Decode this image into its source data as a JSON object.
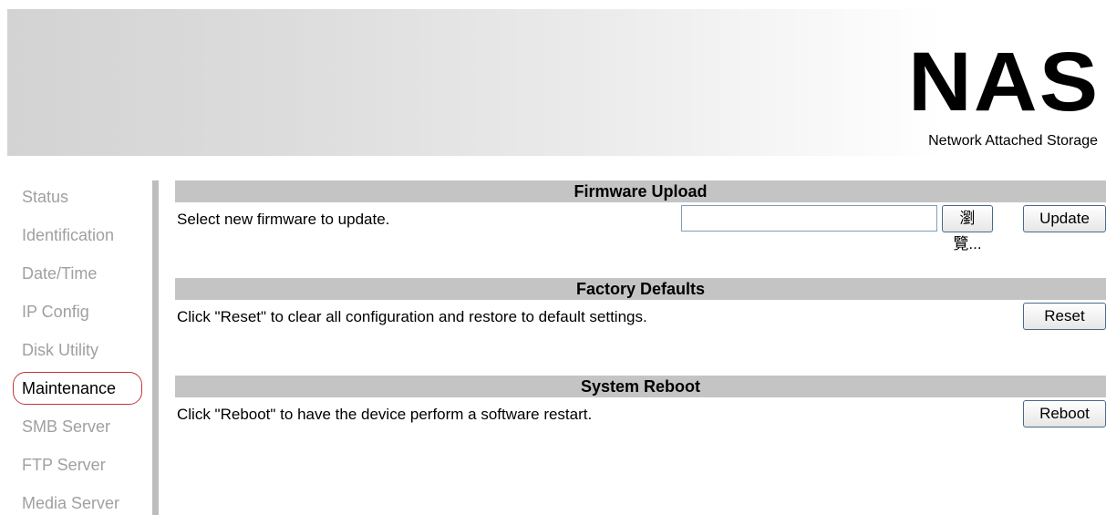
{
  "header": {
    "logo": "NAS",
    "subtitle": "Network Attached Storage"
  },
  "sidebar": {
    "items": [
      {
        "label": "Status",
        "active": false
      },
      {
        "label": "Identification",
        "active": false
      },
      {
        "label": "Date/Time",
        "active": false
      },
      {
        "label": "IP Config",
        "active": false
      },
      {
        "label": "Disk Utility",
        "active": false
      },
      {
        "label": "Maintenance",
        "active": true
      },
      {
        "label": "SMB Server",
        "active": false
      },
      {
        "label": "FTP Server",
        "active": false
      },
      {
        "label": "Media Server",
        "active": false
      }
    ]
  },
  "firmware": {
    "title": "Firmware Upload",
    "text": "Select new firmware to update.",
    "file_value": "",
    "browse_label": "瀏覽...",
    "update_label": "Update"
  },
  "factory": {
    "title": "Factory Defaults",
    "text": "Click \"Reset\" to clear all configuration and restore to default settings.",
    "reset_label": "Reset"
  },
  "reboot": {
    "title": "System Reboot",
    "text": "Click \"Reboot\" to have the device perform a software restart.",
    "reboot_label": "Reboot"
  },
  "colors": {
    "section_header_bg": "#c4c4c4",
    "active_outline": "#c5343c",
    "inactive_nav_text": "#a0a0a0",
    "divider": "#bdbdbd"
  }
}
